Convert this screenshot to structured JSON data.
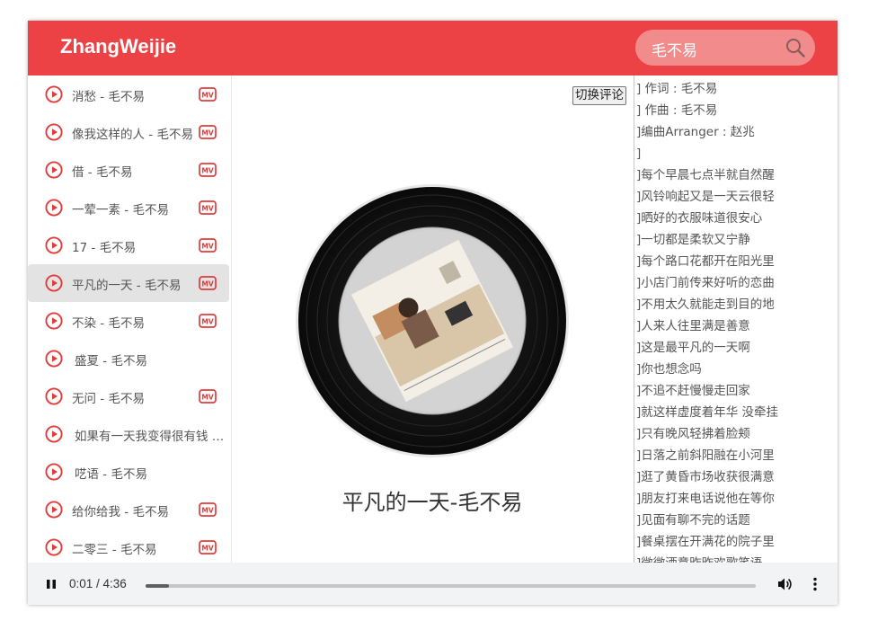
{
  "header": {
    "brand": "ZhangWeijie",
    "search_value": "毛不易",
    "search_icon": "search-icon"
  },
  "playlist": {
    "items": [
      {
        "label": "消愁 - 毛不易",
        "mv": true,
        "active": false
      },
      {
        "label": "像我这样的人 - 毛不易",
        "mv": true,
        "active": false
      },
      {
        "label": "借 - 毛不易",
        "mv": true,
        "active": false
      },
      {
        "label": "一荤一素 - 毛不易",
        "mv": true,
        "active": false
      },
      {
        "label": "17 - 毛不易",
        "mv": true,
        "active": false
      },
      {
        "label": "平凡的一天 - 毛不易",
        "mv": true,
        "active": true
      },
      {
        "label": "不染 - 毛不易",
        "mv": true,
        "active": false
      },
      {
        "label": "盛夏 - 毛不易",
        "mv": false,
        "active": false
      },
      {
        "label": "无问 - 毛不易",
        "mv": true,
        "active": false
      },
      {
        "label": "如果有一天我变得很有钱 - 毛不易",
        "mv": false,
        "active": false
      },
      {
        "label": "呓语 - 毛不易",
        "mv": false,
        "active": false
      },
      {
        "label": "给你给我 - 毛不易",
        "mv": true,
        "active": false
      },
      {
        "label": "二零三 - 毛不易",
        "mv": true,
        "active": false
      }
    ],
    "play_icon": "play-circle-icon",
    "mv_icon": "mv-icon"
  },
  "center": {
    "toggle_label": "切换评论",
    "now_playing": "平凡的一天-毛不易",
    "disc_icon": "vinyl-record-icon"
  },
  "lyrics": [
    "] 作词 : 毛不易",
    "] 作曲 : 毛不易",
    "]编曲Arranger : 赵兆",
    "]",
    "]每个早晨七点半就自然醒",
    "]风铃响起又是一天云很轻",
    "]晒好的衣服味道很安心",
    "]一切都是柔软又宁静",
    "]每个路口花都开在阳光里",
    "]小店门前传来好听的恋曲",
    "]不用太久就能走到目的地",
    "]人来人往里满是善意",
    "]这是最平凡的一天啊",
    "]你也想念吗",
    "]不追不赶慢慢走回家",
    "]就这样虚度着年华 没牵挂",
    "]只有晚风轻拂着脸颊",
    "]日落之前斜阳融在小河里",
    "]逛了黄昏市场收获很满意",
    "]朋友打来电话说他在等你",
    "]见面有聊不完的话题",
    "]餐桌摆在开满花的院子里",
    "]微微酒意昨昨欢歌笑语"
  ],
  "player": {
    "time": "0:01 / 4:36",
    "progress_fraction": 0.004,
    "pause_icon": "pause-icon",
    "volume_icon": "volume-icon",
    "menu_icon": "more-vert-icon"
  },
  "colors": {
    "accent": "#ed4245",
    "search_bg": "#f28b8b",
    "active_row": "#e3e3e3"
  }
}
